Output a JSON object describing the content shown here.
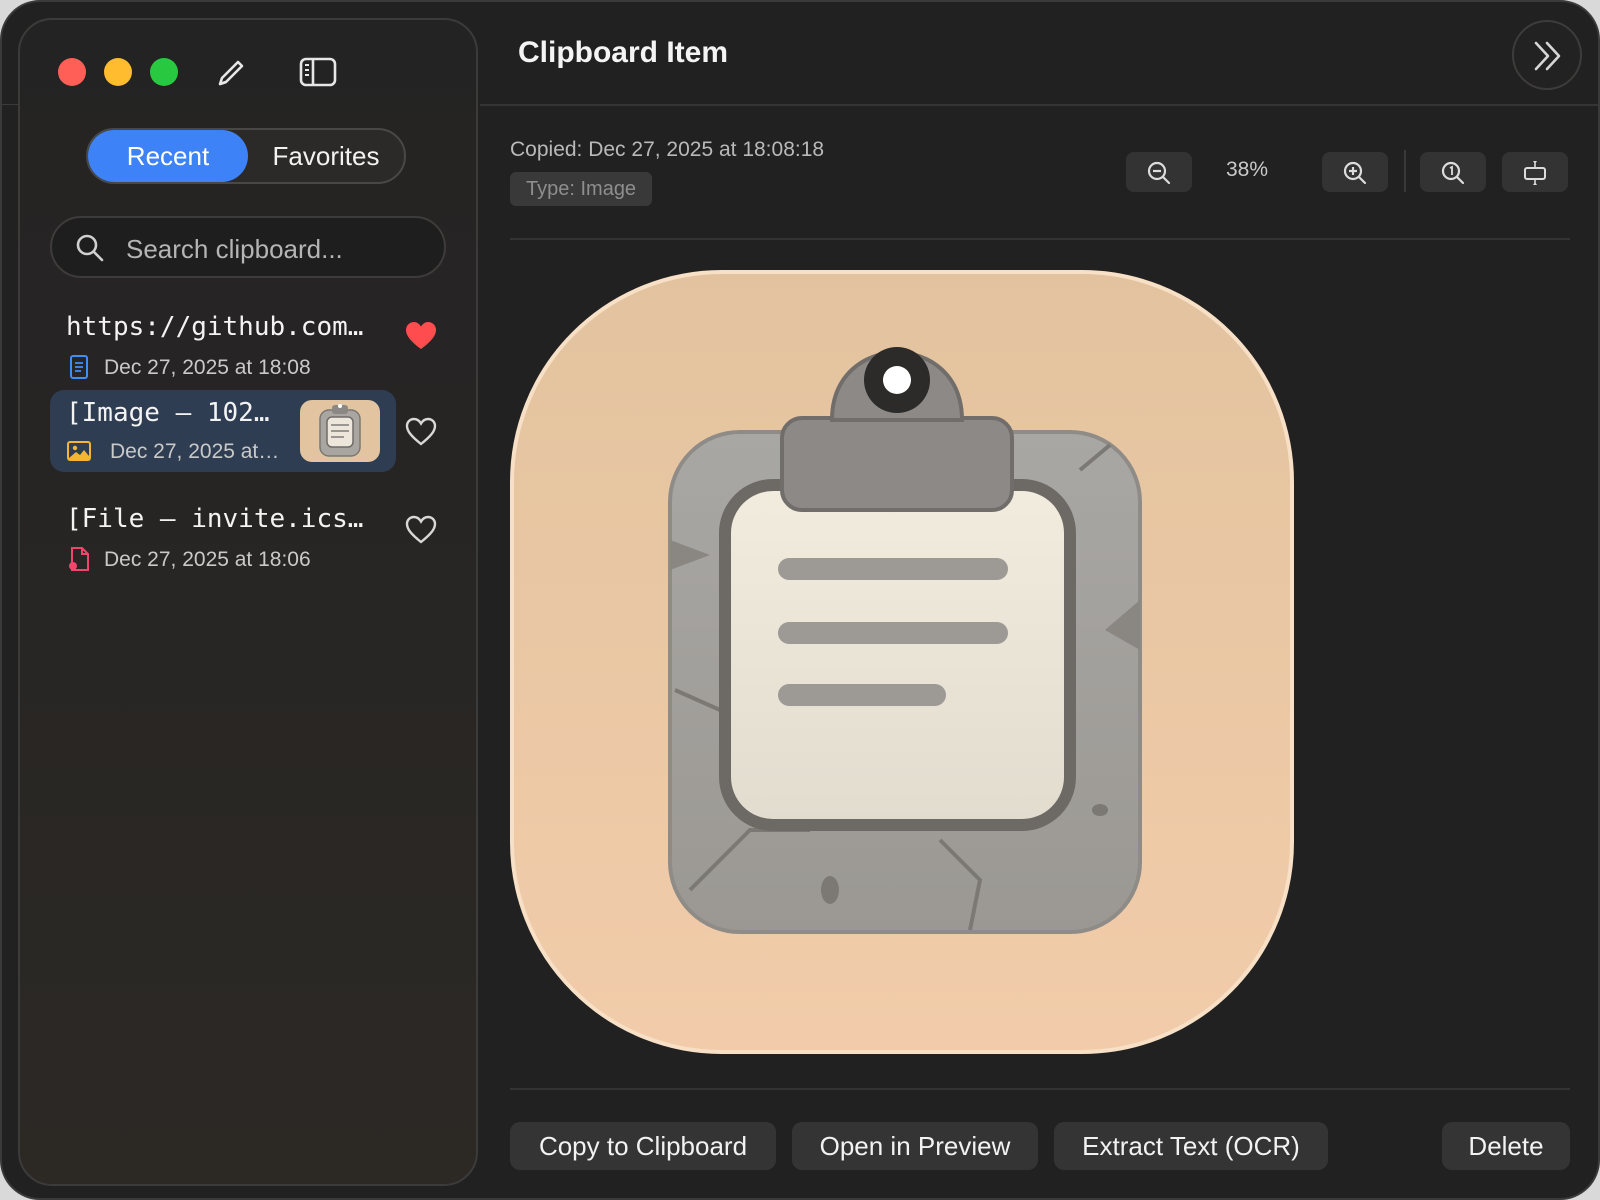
{
  "sidebar": {
    "tabs": {
      "recent": "Recent",
      "favorites": "Favorites"
    },
    "search": {
      "placeholder": "Search clipboard..."
    },
    "items": [
      {
        "title": "https://github.com…",
        "date": "Dec 27, 2025 at 18:08",
        "icon": "document-icon",
        "favorite": true
      },
      {
        "title": "[Image – 102…",
        "date": "Dec 27, 2025 at…",
        "icon": "image-icon",
        "favorite": false
      },
      {
        "title": "[File – invite.ics…",
        "date": "Dec 27, 2025 at 18:06",
        "icon": "file-icon",
        "favorite": false
      }
    ]
  },
  "main": {
    "title": "Clipboard Item",
    "copied": "Copied: Dec 27, 2025 at 18:08:18",
    "type": "Type: Image",
    "zoom": "38%",
    "actions": {
      "copy": "Copy to Clipboard",
      "preview": "Open in Preview",
      "ocr": "Extract Text (OCR)",
      "delete": "Delete"
    }
  },
  "colors": {
    "accent": "#3d82f6",
    "heart_filled": "#ff4d4f",
    "background": "#222121"
  }
}
